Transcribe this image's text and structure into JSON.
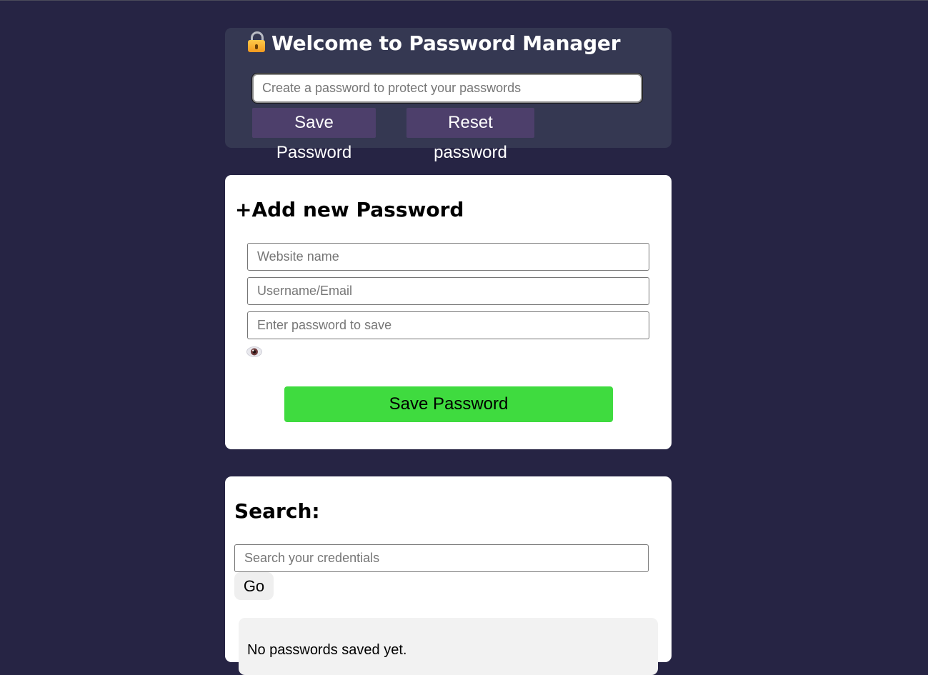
{
  "header": {
    "title": "Welcome to Password Manager",
    "icon": "lock-icon",
    "master_password_placeholder": "Create a password to protect your passwords",
    "save_label": "Save Password",
    "reset_label": "Reset password"
  },
  "add_form": {
    "title": "+Add new Password",
    "website_placeholder": "Website name",
    "username_placeholder": "Username/Email",
    "password_placeholder": "Enter password to save",
    "toggle_icon": "eye-icon",
    "save_label": "Save Password",
    "save_color": "#3fdb3f"
  },
  "search": {
    "title": "Search:",
    "placeholder": "Search your credentials",
    "go_label": "Go",
    "results_text": "No passwords saved yet."
  },
  "colors": {
    "page_background": "#262444",
    "header_card": "#353852",
    "header_button": "#4d3f6b"
  }
}
